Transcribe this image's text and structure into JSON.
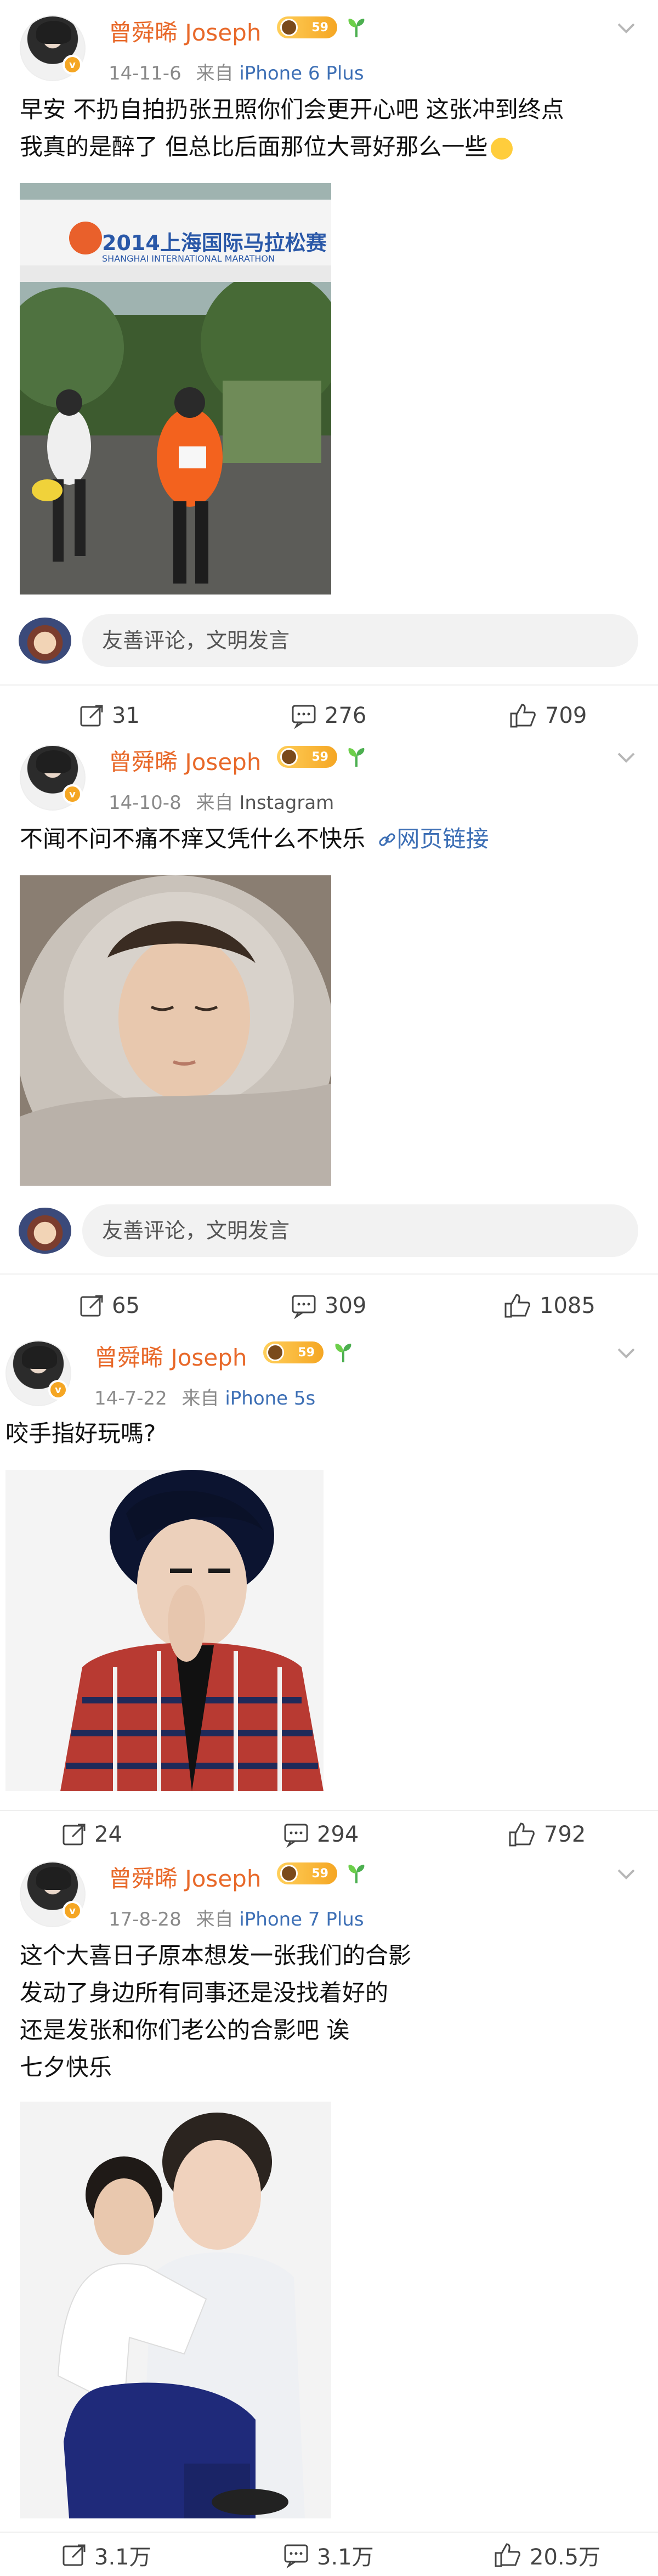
{
  "user": {
    "name": "曾舜晞 Joseph",
    "level": "59",
    "verified_mark": "v"
  },
  "comment_placeholder": "友善评论，文明发言",
  "posts": [
    {
      "date": "14-11-6",
      "from": "来自",
      "source": "iPhone 6 Plus",
      "lines": [
        "早安 不扔自拍扔张丑照你们会更开心吧  这张冲到终点",
        "我真的是醉了 但总比后面那位大哥好那么一些"
      ],
      "image_caption": "2014上海国际马拉松赛",
      "image_caption_en": "SHANGHAI INTERNATIONAL MARATHON",
      "stats": {
        "repost": "31",
        "comment": "276",
        "like": "709"
      }
    },
    {
      "date": "14-10-8",
      "from": "来自",
      "source": "Instagram",
      "lines": [
        "不闻不问不痛不痒又凭什么不快乐"
      ],
      "link": "网页链接",
      "stats": {
        "repost": "65",
        "comment": "309",
        "like": "1085"
      }
    },
    {
      "date": "14-7-22",
      "from": "来自",
      "source": "iPhone 5s",
      "lines": [
        "咬手指好玩嗎?"
      ],
      "stats": {
        "repost": "24",
        "comment": "294",
        "like": "792"
      }
    },
    {
      "date": "17-8-28",
      "from": "来自",
      "source": "iPhone 7 Plus",
      "lines": [
        "这个大喜日子原本想发一张我们的合影",
        "发动了身边所有同事还是没找着好的",
        "还是发张和你们老公的合影吧 诶",
        "七夕快乐"
      ],
      "stats": {
        "repost": "3.1万",
        "comment": "3.1万",
        "like": "20.5万"
      }
    }
  ],
  "colors": {
    "name": "#e8692a",
    "link": "#3d6fb5",
    "meta": "#8a8a8a",
    "level": "#f5a623"
  },
  "icons": [
    "avatar",
    "verified-badge",
    "level-badge",
    "sprout-icon",
    "chevron-down-icon",
    "repost-icon",
    "comment-icon",
    "like-icon",
    "link-icon"
  ]
}
